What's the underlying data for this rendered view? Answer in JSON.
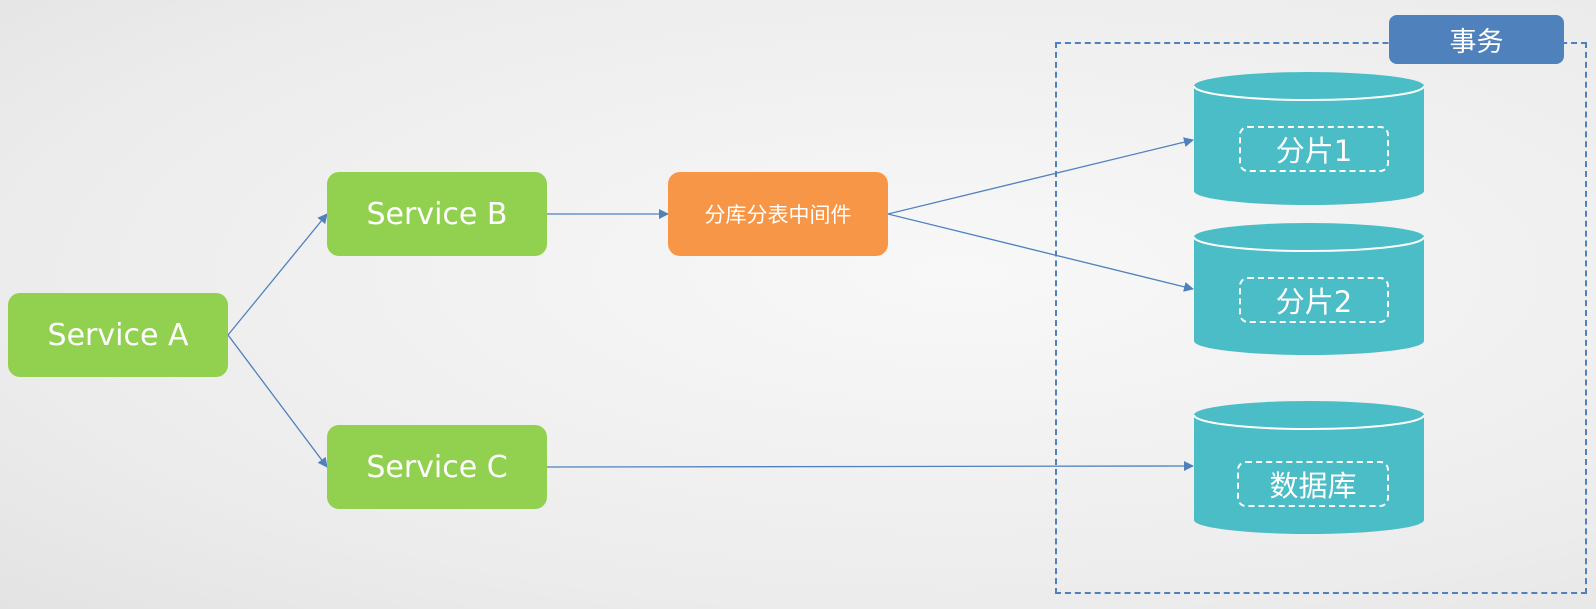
{
  "nodes": {
    "service_a": "Service A",
    "service_b": "Service B",
    "service_c": "Service C",
    "middleware": "分库分表中间件"
  },
  "transaction": {
    "label": "事务"
  },
  "databases": [
    {
      "label": "分片1"
    },
    {
      "label": "分片2"
    },
    {
      "label": "数据库"
    }
  ],
  "colors": {
    "service": "#92d050",
    "middleware": "#f79646",
    "database": "#4bbdc6",
    "transaction": "#4f81bd",
    "arrow": "#4f81bd"
  }
}
